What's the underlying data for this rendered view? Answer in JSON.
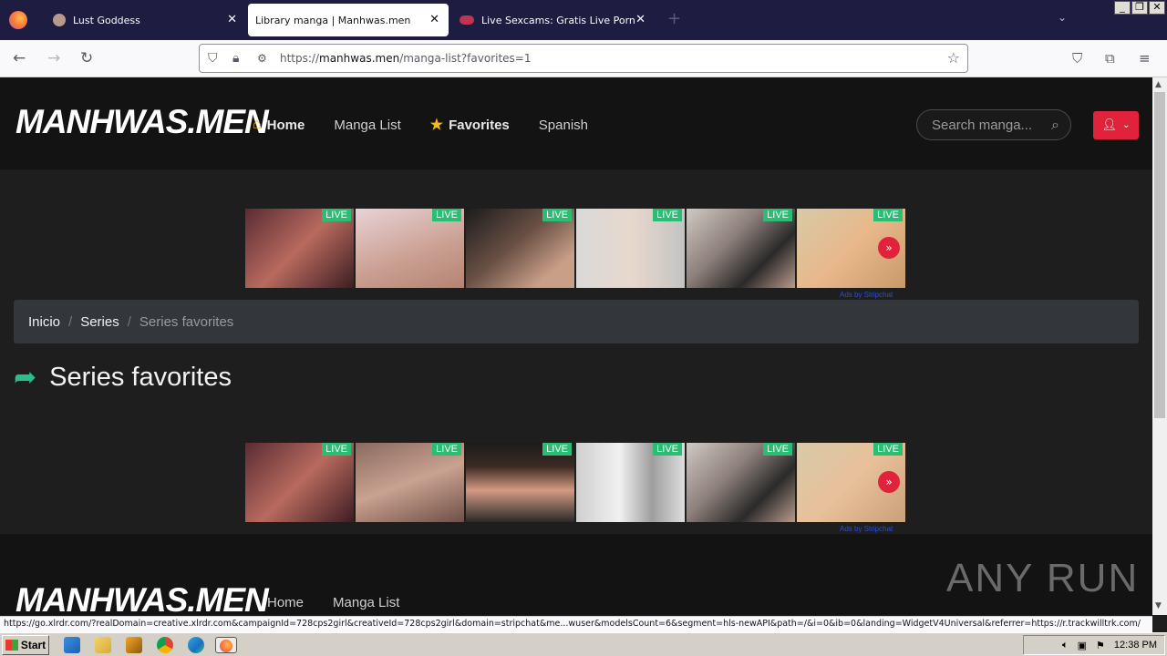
{
  "browser": {
    "tabs": [
      {
        "label": "Lust Goddess",
        "active": false
      },
      {
        "label": "Library manga | Manhwas.men",
        "active": true
      },
      {
        "label": "Live Sexcams: Gratis Live Porn Cha",
        "active": false
      }
    ],
    "url_prefix": "https://",
    "url_domain": "manhwas.men",
    "url_path": "/manga-list?favorites=1",
    "status_url": "https://go.xlrdr.com/?realDomain=creative.xlrdr.com&campaignId=728cps2girl&creativeId=728cps2girl&domain=stripchat&me...wuser&modelsCount=6&segment=hls-newAPI&path=/&i=0&ib=0&landing=WidgetV4Universal&referrer=https://r.trackwilltrk.com/"
  },
  "site": {
    "logo": "MANHWAS.MEN",
    "nav": [
      {
        "label": "Home",
        "icon": "home-icon",
        "bold": true
      },
      {
        "label": "Manga List",
        "icon": "",
        "bold": false
      },
      {
        "label": "Favorites",
        "icon": "star-icon",
        "bold": true
      },
      {
        "label": "Spanish",
        "icon": "",
        "bold": false
      }
    ],
    "search_placeholder": "Search manga...",
    "accent_color": "#e0223b",
    "live_color": "#2bbd73"
  },
  "ads": {
    "live_label": "LIVE",
    "ads_by": "Ads by Stripchat"
  },
  "breadcrumb": {
    "items": [
      "Inicio",
      "Series"
    ],
    "current": "Series favorites"
  },
  "page": {
    "title": "Series favorites"
  },
  "footer": {
    "logo": "MANHWAS.MEN",
    "links": [
      "Home",
      "Manga List"
    ]
  },
  "watermark": "ANY RUN",
  "taskbar": {
    "start_label": "Start",
    "clock": "12:38 PM"
  }
}
